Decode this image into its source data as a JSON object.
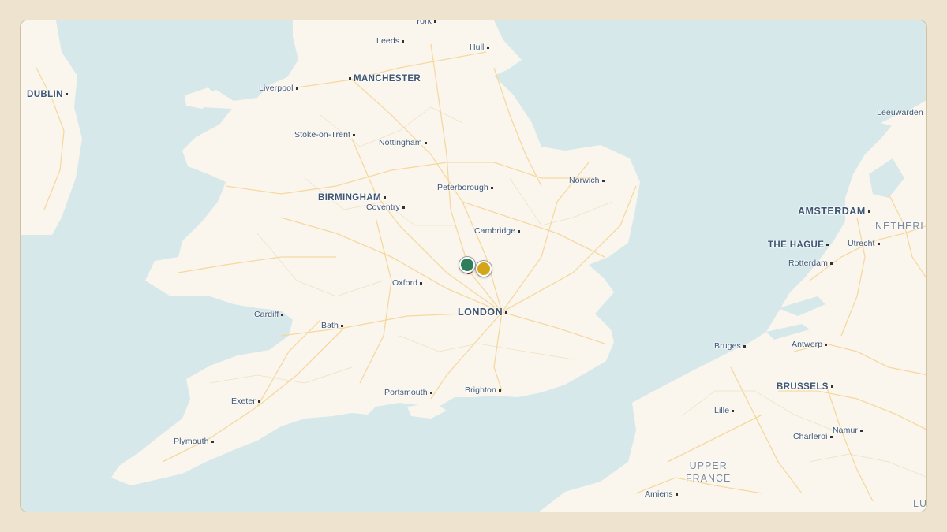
{
  "colors": {
    "sea": "#d6e8ea",
    "land": "#faf6ee",
    "roads": "#f6d79a",
    "frame_bg": "#ede3cf",
    "marker_green": "#2e7d5b",
    "marker_gold": "#d4a51a",
    "marker_dark": "#7a1f24"
  },
  "labels": {
    "york": "York",
    "leeds": "Leeds",
    "hull": "Hull",
    "dublin": "DUBLIN",
    "liverpool": "Liverpool",
    "manchester": "MANCHESTER",
    "stoke": "Stoke-on-Trent",
    "nottingham": "Nottingham",
    "norwich": "Norwich",
    "leeuwarden": "Leeuwarden",
    "birmingham": "BIRMINGHAM",
    "coventry": "Coventry",
    "peterborough": "Peterborough",
    "cambridge": "Cambridge",
    "amsterdam": "AMSTERDAM",
    "netherl": "NETHERL",
    "hague": "THE HAGUE",
    "utrecht": "Utrecht",
    "rotterdam": "Rotterdam",
    "oxford": "Oxford",
    "cardiff": "Cardiff",
    "london": "LONDON",
    "bath": "Bath",
    "bruges": "Bruges",
    "antwerp": "Antwerp",
    "brussels": "BRUSSELS",
    "portsmouth": "Portsmouth",
    "brighton": "Brighton",
    "exeter": "Exeter",
    "lille": "Lille",
    "namur": "Namur",
    "charleroi": "Charleroi",
    "plymouth": "Plymouth",
    "upper_france_1": "UPPER",
    "upper_france_2": "FRANCE",
    "amiens": "Amiens",
    "lu": "LU"
  },
  "markers": [
    {
      "name": "marker-green",
      "color": "#2e7d5b"
    },
    {
      "name": "marker-gold",
      "color": "#d4a51a"
    }
  ]
}
